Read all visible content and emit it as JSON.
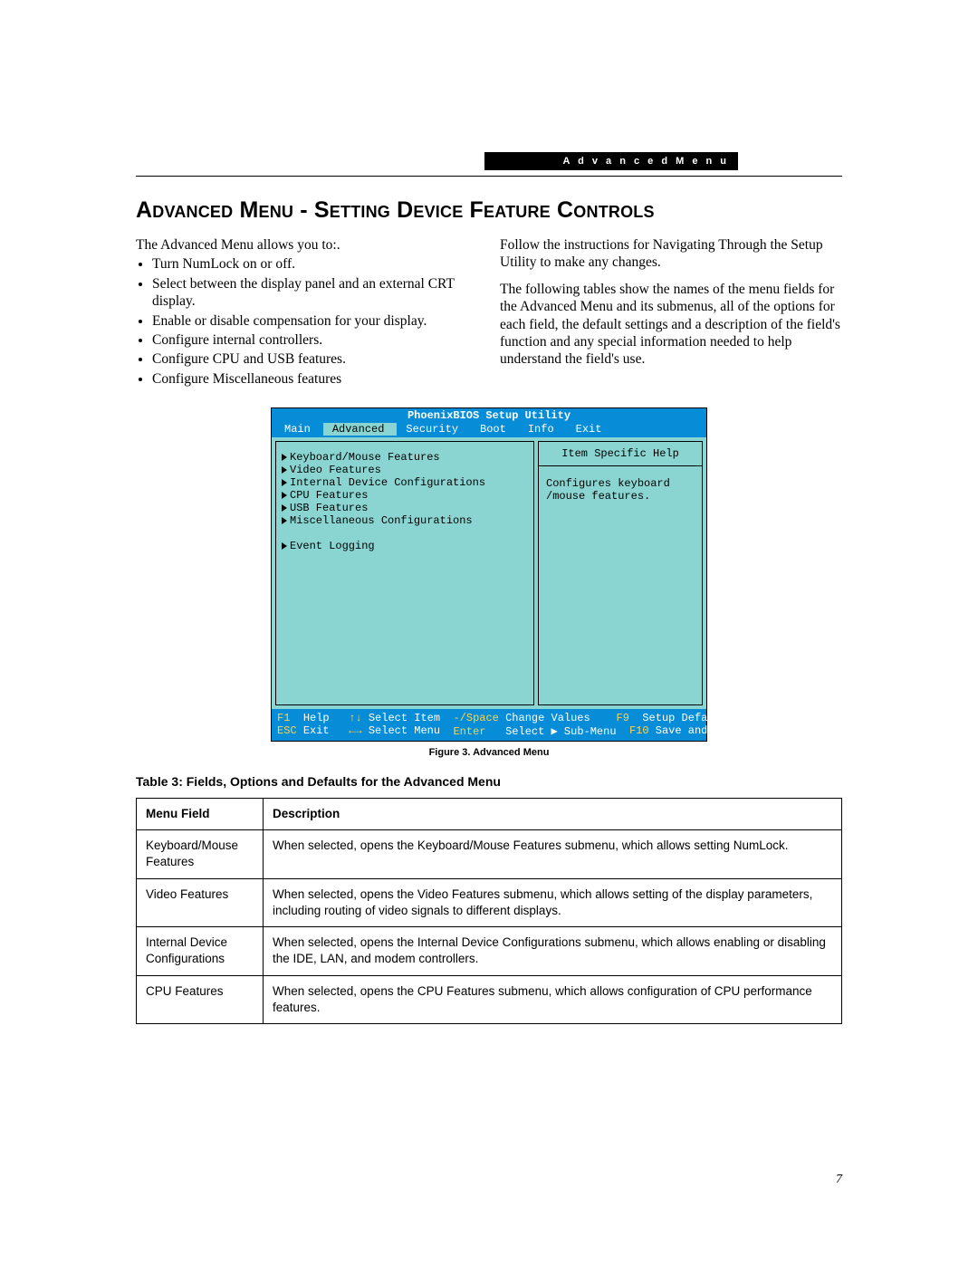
{
  "header": {
    "label": "A d v a n c e d   M e n u"
  },
  "title": "Advanced Menu - Setting Device Feature Controls",
  "intro_left": "The Advanced Menu allows you to:.",
  "bullets_left": [
    "Turn NumLock on or off.",
    "Select between the display panel and an external CRT display.",
    "Enable or disable compensation for your display.",
    "Configure internal controllers.",
    "Configure CPU and USB features.",
    "Configure Miscellaneous features"
  ],
  "para_right_1": "Follow the instructions for Navigating Through the Setup Utility to make any changes.",
  "para_right_2": "The following tables show the names of the menu fields for the Advanced Menu and its submenus, all of the options for each field, the default settings and a description of the field's function and any special information needed to help understand the field's use.",
  "bios": {
    "title": "PhoenixBIOS Setup Utility",
    "tabs": [
      "Main",
      "Advanced",
      "Security",
      "Boot",
      "Info",
      "Exit"
    ],
    "selected_tab": "Advanced",
    "items": [
      "Keyboard/Mouse Features",
      "Video Features",
      "Internal Device Configurations",
      "CPU Features",
      "USB Features",
      "Miscellaneous Configurations"
    ],
    "extra_item": "Event Logging",
    "help_header": "Item Specific Help",
    "help_text": "Configures keyboard /mouse features.",
    "footer": {
      "f1": {
        "key": "F1",
        "label": "Help"
      },
      "esc": {
        "key": "ESC",
        "label": "Exit"
      },
      "ud": {
        "key": "↑↓",
        "label": "Select Item"
      },
      "lr": {
        "key": "←→",
        "label": "Select Menu"
      },
      "sp": {
        "key": "-/Space",
        "label": "Change Values"
      },
      "ent": {
        "key": "Enter",
        "label": "Select ▶ Sub-Menu"
      },
      "f9": {
        "key": "F9",
        "label": "Setup Defaults"
      },
      "f10": {
        "key": "F10",
        "label": "Save and Exit"
      }
    }
  },
  "figure_caption": "Figure 3.  Advanced Menu",
  "table_caption": "Table 3: Fields, Options and Defaults for the Advanced Menu",
  "table": {
    "headers": {
      "c1": "Menu Field",
      "c2": "Description"
    },
    "rows": [
      {
        "c1": "Keyboard/Mouse Features",
        "c2": "When selected, opens the Keyboard/Mouse Features submenu, which allows setting NumLock."
      },
      {
        "c1": "Video Features",
        "c2": "When selected, opens the Video Features submenu, which allows setting of the display parameters, including routing of video signals to different displays."
      },
      {
        "c1": "Internal Device Configurations",
        "c2": "When selected, opens the Internal Device Configurations submenu, which allows enabling or disabling the IDE, LAN, and modem controllers."
      },
      {
        "c1": "CPU Features",
        "c2": "When selected, opens the CPU Features submenu, which allows configuration of CPU performance features."
      }
    ]
  },
  "page_number": "7"
}
